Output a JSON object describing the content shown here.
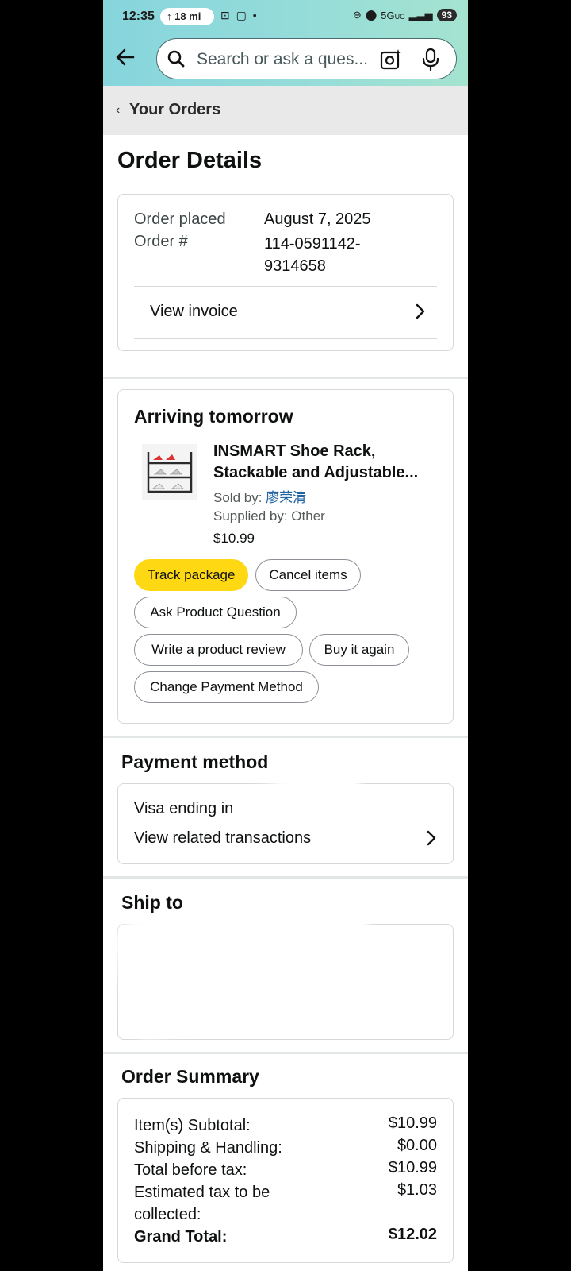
{
  "status_bar": {
    "time": "12:35",
    "upload_pill": "↑ 18 mi",
    "network": "5G",
    "network_suffix": "UC",
    "battery": "93"
  },
  "header": {
    "search_placeholder": "Search or ask a ques...",
    "icons": [
      "back-arrow-icon",
      "search-icon",
      "camera-icon",
      "mic-icon"
    ]
  },
  "breadcrumb": {
    "label": "Your Orders"
  },
  "page_title": "Order Details",
  "order_info": {
    "placed_label": "Order placed",
    "placed_value": "August 7, 2025",
    "number_label": "Order #",
    "number_value": "114-0591142-9314658",
    "invoice_label": "View invoice"
  },
  "shipment": {
    "heading": "Arriving tomorrow",
    "product_title": "INSMART Shoe Rack, Stackable and Adjustable...",
    "sold_by_label": "Sold by: ",
    "sold_by_value": "廖荣清",
    "supplied_by": "Supplied by: Other",
    "price": "$10.99",
    "buttons": {
      "track": "Track package",
      "cancel": "Cancel items",
      "ask": "Ask Product Question",
      "review": "Write a product review",
      "buy_again": "Buy it again",
      "change_payment": "Change Payment Method"
    }
  },
  "payment": {
    "heading": "Payment method",
    "visa": "Visa ending in",
    "transactions": "View related transactions"
  },
  "ship_to": {
    "heading": "Ship to"
  },
  "summary": {
    "heading": "Order Summary",
    "rows": [
      {
        "label": "Item(s) Subtotal:",
        "value": "$10.99"
      },
      {
        "label": "Shipping & Handling:",
        "value": "$0.00"
      },
      {
        "label": "Total before tax:",
        "value": "$10.99"
      },
      {
        "label": "Estimated tax to be collected:",
        "value": "$1.03"
      },
      {
        "label": "Grand Total:",
        "value": "$12.02"
      }
    ]
  },
  "colors": {
    "primary_button": "#ffd814",
    "link": "#2162a1",
    "header_gradient_start": "#86d5dd",
    "header_gradient_end": "#a5e3d0"
  }
}
